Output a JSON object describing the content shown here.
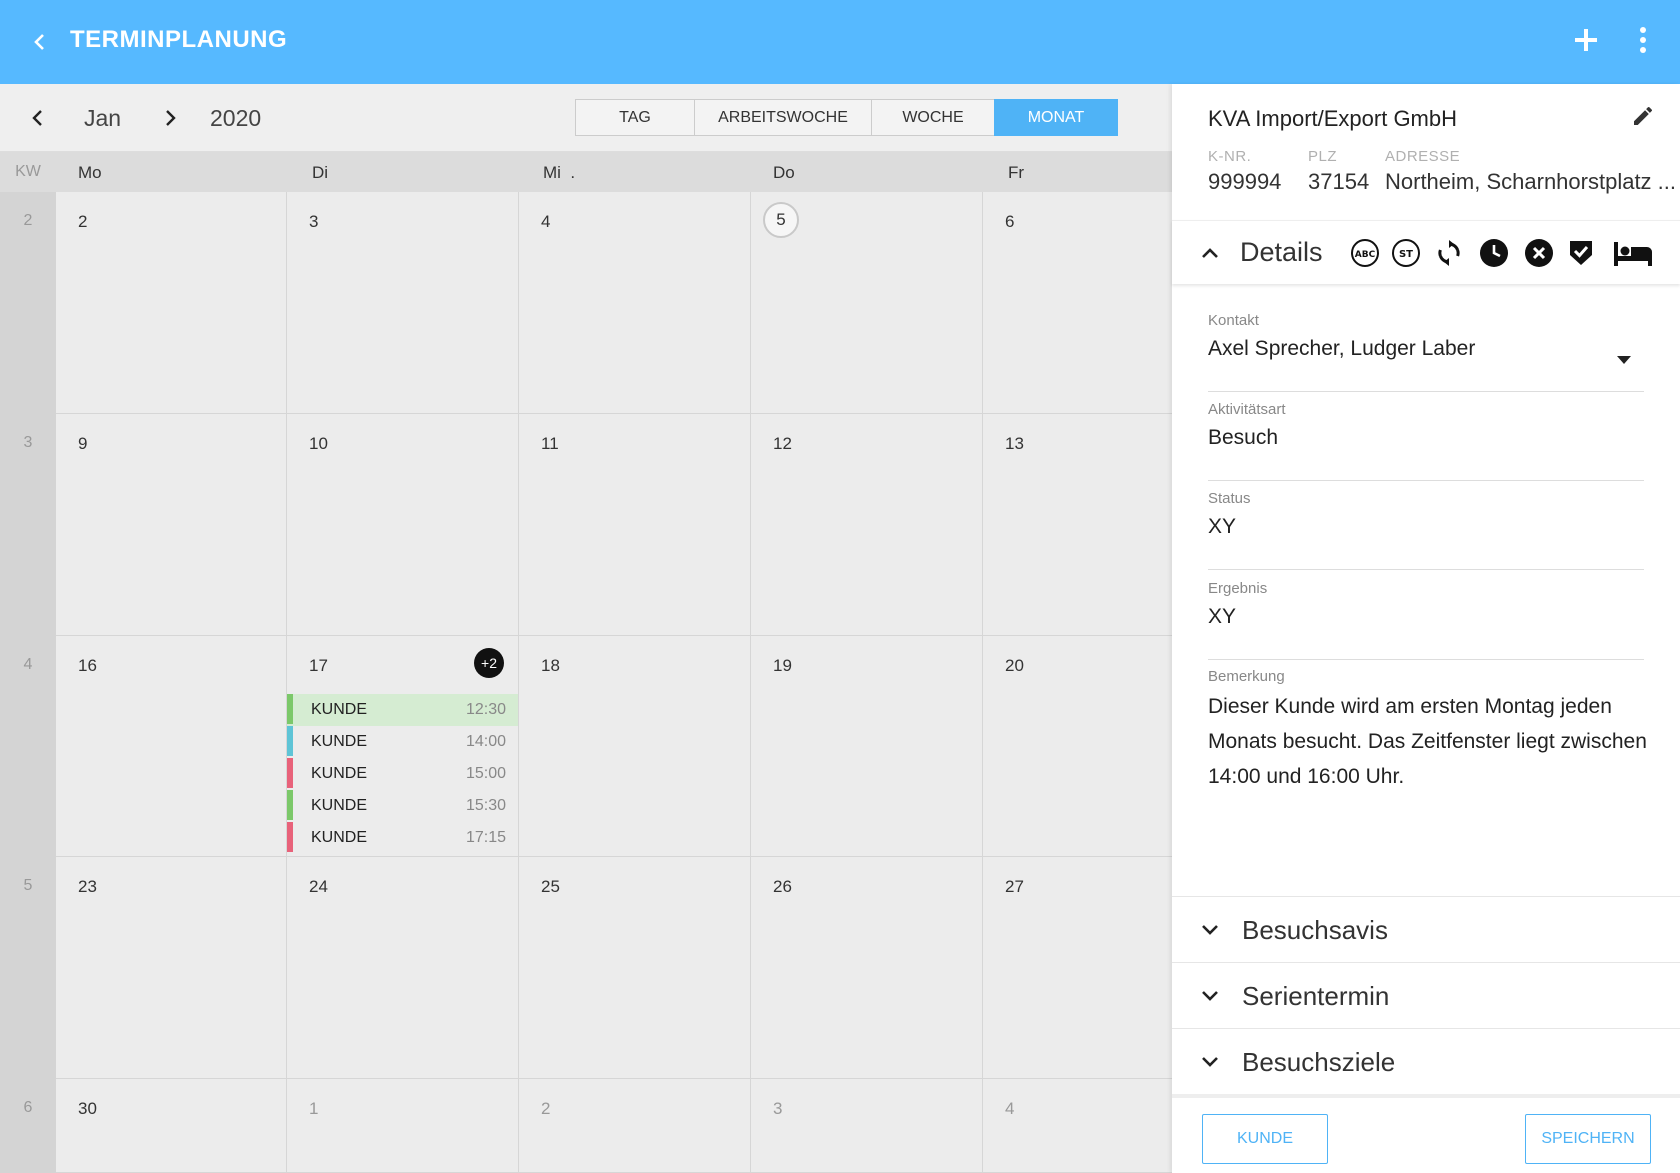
{
  "appbar": {
    "title": "TERMINPLANUNG"
  },
  "calendar": {
    "month": "Jan",
    "year": "2020",
    "views": [
      {
        "label": "TAG",
        "active": false
      },
      {
        "label": "ARBEITSWOCHE",
        "active": false
      },
      {
        "label": "WOCHE",
        "active": false
      },
      {
        "label": "MONAT",
        "active": true
      }
    ],
    "kw_header": "KW",
    "day_headers": [
      "Mo",
      "Di",
      "Mi  .",
      "Do",
      "Fr"
    ],
    "weeks": [
      {
        "kw": "2",
        "days": [
          "2",
          "3",
          "4",
          "5",
          "6"
        ]
      },
      {
        "kw": "3",
        "days": [
          "9",
          "10",
          "11",
          "12",
          "13"
        ]
      },
      {
        "kw": "4",
        "days": [
          "16",
          "17",
          "18",
          "19",
          "20"
        ]
      },
      {
        "kw": "5",
        "days": [
          "23",
          "24",
          "25",
          "26",
          "27"
        ]
      },
      {
        "kw": "6",
        "days": [
          "30",
          "1",
          "2",
          "3",
          "4"
        ]
      }
    ],
    "today": "5",
    "more_badge": "+2",
    "events": [
      {
        "name": "KUNDE",
        "time": "12:30",
        "color": "#7cc86a",
        "highlight": true
      },
      {
        "name": "KUNDE",
        "time": "14:00",
        "color": "#5ec4d6",
        "highlight": false
      },
      {
        "name": "KUNDE",
        "time": "15:00",
        "color": "#e8627a",
        "highlight": false
      },
      {
        "name": "KUNDE",
        "time": "15:30",
        "color": "#7cc86a",
        "highlight": false
      },
      {
        "name": "KUNDE",
        "time": "17:15",
        "color": "#e8627a",
        "highlight": false
      }
    ]
  },
  "panel": {
    "company": "KVA Import/Export GmbH",
    "meta": [
      {
        "label": "K-NR.",
        "value": "999994"
      },
      {
        "label": "PLZ",
        "value": "37154"
      },
      {
        "label": "ADRESSE",
        "value": "Northeim, Scharnhorstplatz ..."
      }
    ],
    "details_label": "Details",
    "detail_icons": [
      {
        "name": "abc-circle-icon",
        "text": "ABC"
      },
      {
        "name": "st-circle-icon",
        "text": "ST"
      },
      {
        "name": "sync-icon",
        "text": ""
      },
      {
        "name": "clock-icon",
        "text": ""
      },
      {
        "name": "cancel-circle-icon",
        "text": ""
      },
      {
        "name": "shield-check-icon",
        "text": ""
      },
      {
        "name": "bed-icon",
        "text": ""
      }
    ],
    "fields": {
      "kontakt": {
        "label": "Kontakt",
        "value": "Axel Sprecher, Ludger Laber"
      },
      "aktivitaetsart": {
        "label": "Aktivitätsart",
        "value": "Besuch"
      },
      "status": {
        "label": "Status",
        "value": "XY"
      },
      "ergebnis": {
        "label": "Ergebnis",
        "value": "XY"
      },
      "bemerkung": {
        "label": "Bemerkung",
        "value": "Dieser Kunde wird am ersten Montag jeden Monats besucht. Das Zeitfenster liegt zwischen 14:00 und 16:00 Uhr."
      }
    },
    "sections": [
      "Besuchsavis",
      "Serientermin",
      "Besuchsziele"
    ],
    "buttons": {
      "kunde": "KUNDE",
      "speichern": "SPEICHERN"
    }
  },
  "colors": {
    "appbar": "#56b9ff",
    "accent": "#4fb3f6"
  }
}
